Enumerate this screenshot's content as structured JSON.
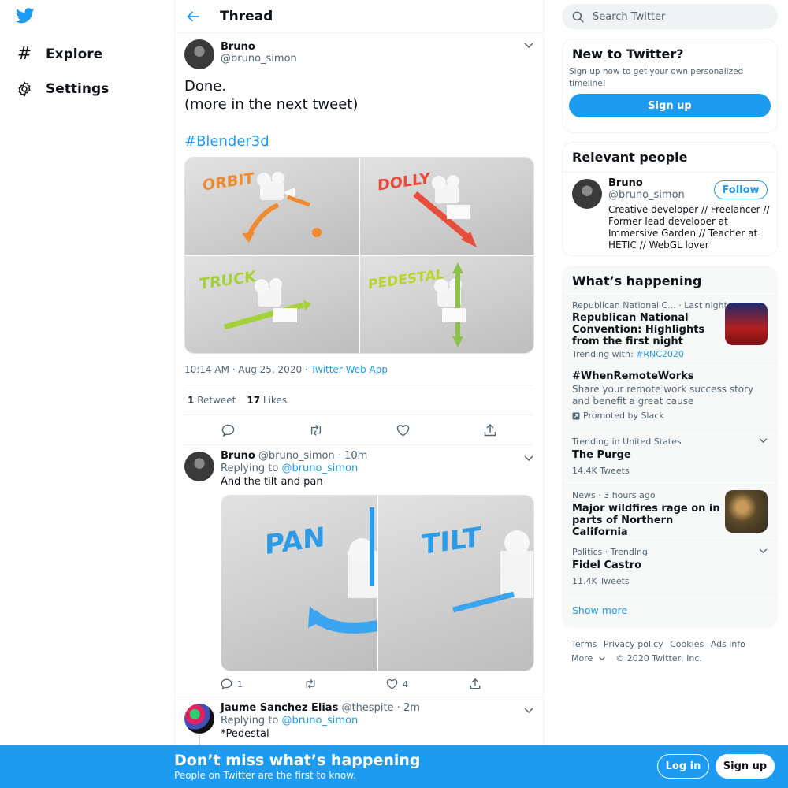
{
  "nav": {
    "explore_label": "Explore",
    "settings_label": "Settings"
  },
  "thread": {
    "title": "Thread",
    "main_tweet": {
      "name": "Bruno",
      "handle": "@bruno_simon",
      "text_line1": "Done.",
      "text_line2": "(more in the next tweet)",
      "hashtag": "#Blender3d",
      "images": [
        "ORBIT",
        "DOLLY",
        "TRUCK",
        "PEDESTAL"
      ],
      "time": "10:14 AM · Aug 25, 2020 · ",
      "source": "Twitter Web App",
      "retweets_count": "1",
      "retweets_label": "Retweet",
      "likes_count": "17",
      "likes_label": "Likes"
    },
    "reply1": {
      "name": "Bruno",
      "handle": "@bruno_simon",
      "time": " · 10m",
      "replying_prefix": "Replying to ",
      "replying_to": "@bruno_simon",
      "text": "And the tilt and pan",
      "images": [
        "PAN",
        "TILT"
      ],
      "reply_count": "1",
      "like_count": "4"
    },
    "reply2": {
      "name": "Jaume Sanchez Elias",
      "handle": "@thespite",
      "time": " · 2m",
      "replying_prefix": "Replying to ",
      "replying_to": "@bruno_simon",
      "text": "*Pedestal"
    }
  },
  "search": {
    "placeholder": "Search Twitter"
  },
  "new_to_twitter": {
    "title": "New to Twitter?",
    "text": "Sign up now to get your own personalized timeline!",
    "button": "Sign up"
  },
  "relevant_people": {
    "title": "Relevant people",
    "name": "Bruno",
    "handle": "@bruno_simon",
    "follow": "Follow",
    "bio": "Creative developer // Freelancer // Former lead developer at Immersive Garden // Teacher at HETIC // WebGL lover"
  },
  "whats_happening": {
    "title": "What’s happening",
    "trends": [
      {
        "meta": "Republican National C... · Last night",
        "title": "Republican National Convention: Highlights from the first night",
        "extra_prefix": "Trending with: ",
        "extra_link": "#RNC2020"
      },
      {
        "title": "#WhenRemoteWorks",
        "desc": "Share your remote work success story and benefit a great cause",
        "promo": "Promoted by Slack"
      },
      {
        "meta": "Trending in United States",
        "title": "The Purge",
        "count": "14.4K Tweets"
      },
      {
        "meta": "News · 3 hours ago",
        "title": "Major wildfires rage on in parts of Northern California"
      },
      {
        "meta": "Politics · Trending",
        "title": "Fidel Castro",
        "count": "11.4K Tweets"
      }
    ],
    "show_more": "Show more"
  },
  "footer": {
    "links": [
      "Terms",
      "Privacy policy",
      "Cookies",
      "Ads info"
    ],
    "more": "More",
    "copyright": "© 2020 Twitter, Inc."
  },
  "banner": {
    "title": "Don’t miss what’s happening",
    "subtitle": "People on Twitter are the first to know.",
    "login": "Log in",
    "signup": "Sign up"
  },
  "colors": {
    "accent": "#1d9bf0",
    "text": "#0f1419",
    "secondary": "#536471"
  }
}
